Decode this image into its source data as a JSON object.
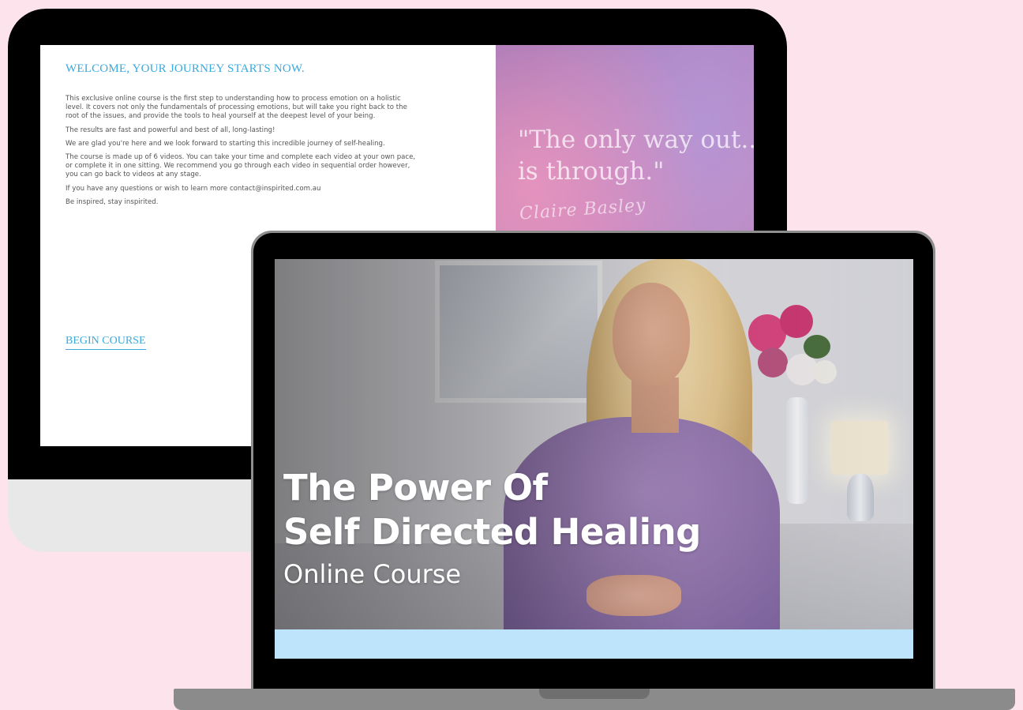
{
  "colors": {
    "background": "#fde3ec",
    "accent_blue": "#39a9de",
    "video_bar": "#bee4fb"
  },
  "desktop": {
    "welcome_title": "WELCOME, YOUR JOURNEY STARTS NOW.",
    "paragraphs": [
      "This exclusive online course is the first step to understanding how to process emotion on a holistic level.  It covers not only the fundamentals of processing emotions, but will take you right back to the root of the issues, and provide the tools to heal yourself at the deepest level of your being.",
      "The results are fast and powerful and best of all, long-lasting!",
      "We are glad you're here and we look forward to starting this incredible journey of self-healing.",
      "The course is made up of 6 videos. You can take your time and complete each video at your own pace, or complete it in one sitting. We recommend you go through each video in sequential order however, you can go back to videos at any stage.",
      "If you have any questions or wish to learn more contact@inspirited.com.au",
      "Be inspired, stay inspirited."
    ],
    "begin_button": "BEGIN COURSE",
    "quote": "\"The only way out..\nis through.\"",
    "signature": "Claire Basley"
  },
  "laptop": {
    "title_line1": "The Power Of",
    "title_line2": "Self Directed Healing",
    "subtitle": "Online Course"
  }
}
